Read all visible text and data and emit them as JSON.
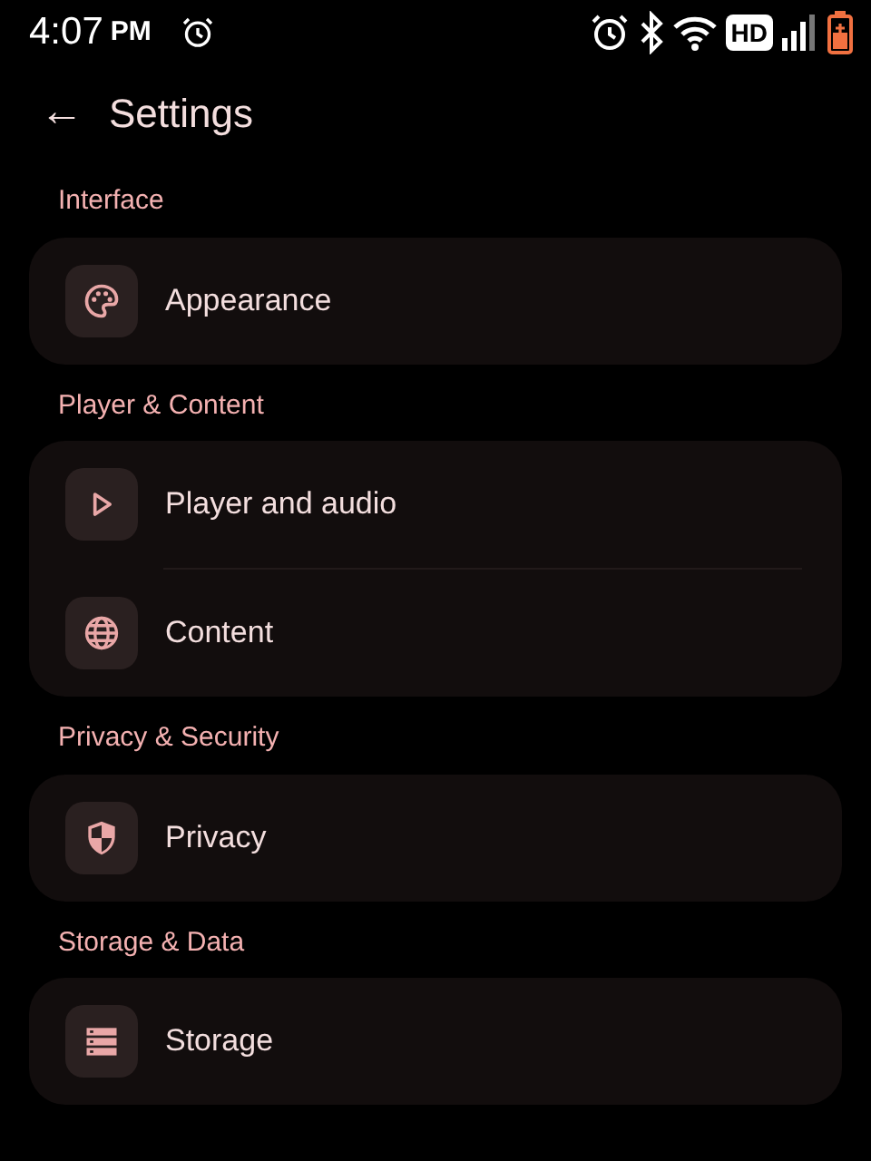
{
  "status_bar": {
    "time": "4:07",
    "period": "PM",
    "network_badge": "HD"
  },
  "header": {
    "back": "←",
    "title": "Settings"
  },
  "sections": [
    {
      "title": "Interface",
      "items": [
        {
          "label": "Appearance"
        }
      ]
    },
    {
      "title": "Player & Content",
      "items": [
        {
          "label": "Player and audio"
        },
        {
          "label": "Content"
        }
      ]
    },
    {
      "title": "Privacy & Security",
      "items": [
        {
          "label": "Privacy"
        }
      ]
    },
    {
      "title": "Storage & Data",
      "items": [
        {
          "label": "Storage"
        }
      ]
    }
  ]
}
